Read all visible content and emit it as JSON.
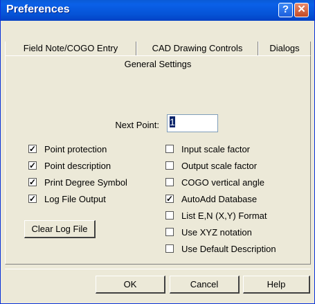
{
  "window": {
    "title": "Preferences"
  },
  "titlebar_buttons": {
    "help": "?",
    "close": "✕"
  },
  "tabs": [
    {
      "label": "Field Note/COGO Entry"
    },
    {
      "label": "CAD Drawing Controls"
    },
    {
      "label": "Dialogs"
    }
  ],
  "panel": {
    "title": "General Settings",
    "next_point": {
      "label": "Next Point:",
      "value": "1"
    },
    "left_options": [
      {
        "label": "Point protection",
        "checked": true
      },
      {
        "label": "Point description",
        "checked": true
      },
      {
        "label": "Print Degree Symbol",
        "checked": true
      },
      {
        "label": "Log File Output",
        "checked": true
      }
    ],
    "right_options": [
      {
        "label": "Input scale factor",
        "checked": false
      },
      {
        "label": "Output scale factor",
        "checked": false
      },
      {
        "label": "COGO vertical angle",
        "checked": false
      },
      {
        "label": "AutoAdd Database",
        "checked": true
      },
      {
        "label": "List E,N (X,Y) Format",
        "checked": false
      },
      {
        "label": "Use XYZ notation",
        "checked": false
      },
      {
        "label": "Use Default Description",
        "checked": false
      }
    ],
    "clear_log_label": "Clear Log File"
  },
  "footer": {
    "ok_label": "OK",
    "cancel_label": "Cancel",
    "help_label": "Help"
  },
  "colors": {
    "titlebar": "#0a5ad6",
    "dialog_bg": "#ece9d8",
    "close_button": "#c44a25",
    "selection": "#0a246a"
  }
}
